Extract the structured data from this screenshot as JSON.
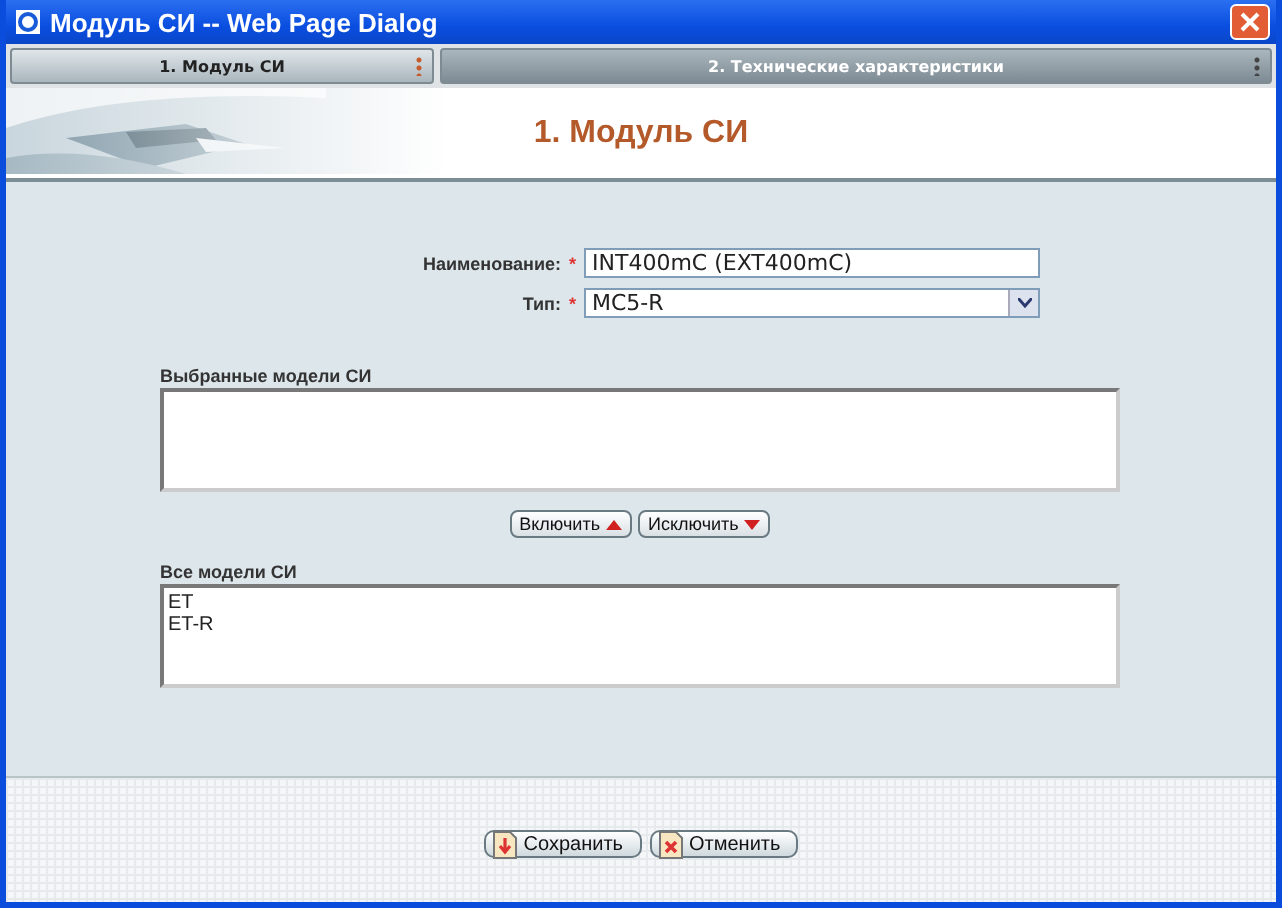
{
  "window": {
    "title": "Модуль СИ -- Web Page Dialog"
  },
  "tabs": [
    {
      "label": "1. Модуль СИ",
      "selected": true
    },
    {
      "label": "2. Технические характеристики",
      "selected": false
    }
  ],
  "heading": "1. Модуль СИ",
  "fields": [
    {
      "kind": "text",
      "label": "Наименование:",
      "required_mark": "*",
      "value": "INT400mC (EXT400mC)"
    },
    {
      "kind": "select",
      "label": "Тип:",
      "required_mark": "*",
      "value": "MC5-R"
    }
  ],
  "selected_models": {
    "label": "Выбранные модели СИ"
  },
  "move_buttons": [
    {
      "label": "Включить",
      "kind": "up"
    },
    {
      "label": "Исключить",
      "kind": "down"
    }
  ],
  "all_models": {
    "label": "Все модели СИ",
    "items": [
      "ET",
      "ET-R"
    ]
  },
  "footer_buttons": [
    {
      "label": "Сохранить",
      "kind": "save"
    },
    {
      "label": "Отменить",
      "kind": "cancel"
    }
  ]
}
